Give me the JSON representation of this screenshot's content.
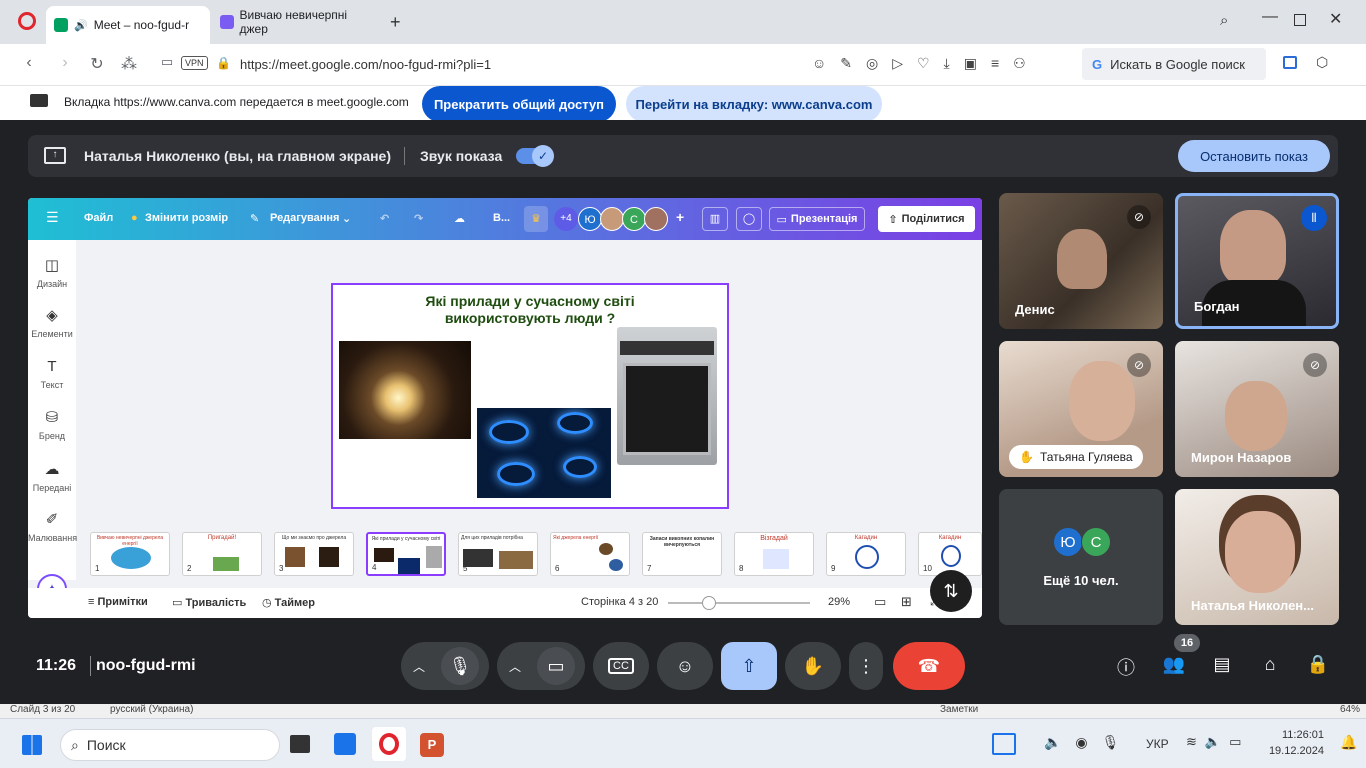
{
  "browser": {
    "tabs": [
      {
        "label": "Meet – noo-fgud-r"
      },
      {
        "label": "Вивчаю невичерпні джер"
      }
    ],
    "url": "https://meet.google.com/noo-fgud-rmi?pli=1",
    "vpn": "VPN",
    "search_label": "Искать в Google поиск"
  },
  "share_notice": {
    "text": "Вкладка https://www.canva.com передается в meet.google.com",
    "stop_label": "Прекратить общий доступ",
    "goto_label": "Перейти на вкладку: www.canva.com"
  },
  "presenting": {
    "name": "Наталья Николенко (вы, на главном экране)",
    "sound_label": "Звук показа",
    "stop_button": "Остановить показ"
  },
  "canva": {
    "menu": {
      "file": "Файл",
      "resize": "Змінити розмір",
      "edit": "Редагування",
      "more": "В...",
      "plus_count": "+4",
      "avatar_yu": "Ю",
      "avatar_s": "С",
      "present": "Презентація",
      "share": "Поділитися"
    },
    "sidebar": [
      {
        "label": "Дизайн",
        "icon": "design-icon"
      },
      {
        "label": "Елементи",
        "icon": "elements-icon"
      },
      {
        "label": "Текст",
        "icon": "text-icon"
      },
      {
        "label": "Бренд",
        "icon": "brand-icon"
      },
      {
        "label": "Передані",
        "icon": "uploads-icon"
      },
      {
        "label": "Малювання",
        "icon": "draw-icon"
      }
    ],
    "slide": {
      "title_line1": "Які прилади  у сучасному світі",
      "title_line2": "використовують  люди ?"
    },
    "thumbnails": [
      {
        "n": "1",
        "t": "Вивчаю невичерпні джерела енергії"
      },
      {
        "n": "2",
        "t": "Пригадай!"
      },
      {
        "n": "3",
        "t": "Що ми знаємо про джерела"
      },
      {
        "n": "4",
        "t": "Які прилади у сучасному світі"
      },
      {
        "n": "5",
        "t": "Для цих приладів потрібна"
      },
      {
        "n": "6",
        "t": "Які джерела енергії"
      },
      {
        "n": "7",
        "t": "Запаси викопних копалин вичерпуються"
      },
      {
        "n": "8",
        "t": "Візгадай"
      },
      {
        "n": "9",
        "t": "Кагадин"
      },
      {
        "n": "10",
        "t": "Кагадин"
      }
    ],
    "bottom": {
      "notes": "Примітки",
      "duration": "Тривалість",
      "timer": "Таймер",
      "page": "Сторінка 4 з 20",
      "zoom": "29%",
      "zoom_level": 0.29
    }
  },
  "participants": [
    {
      "name": "Денис",
      "muted": true
    },
    {
      "name": "Богдан",
      "speaking": true
    },
    {
      "name": "Татьяна Гуляева",
      "muted": true
    },
    {
      "name": "Мирон Назаров",
      "muted": true
    },
    {
      "name": "Ещё 10 чел.",
      "avatar1": "Ю",
      "avatar2": "С"
    },
    {
      "name": "Наталья Николен..."
    }
  ],
  "meeting": {
    "time": "11:26",
    "code": "noo-fgud-rmi",
    "people_count": "16"
  },
  "behind": {
    "left": "Слайд 3 из 20",
    "lang": "русский (Украина)",
    "notes": "Заметки",
    "zoom": "64%"
  },
  "taskbar": {
    "search": "Поиск",
    "lang": "УКР",
    "time": "11:26:01",
    "date": "19.12.2024"
  },
  "colors": {
    "meet_bg": "#202124",
    "canva_accent": "#8b3dff",
    "end_call": "#ea4335",
    "share_active": "#a8c7fa",
    "stop_share": "#0b57d0"
  }
}
